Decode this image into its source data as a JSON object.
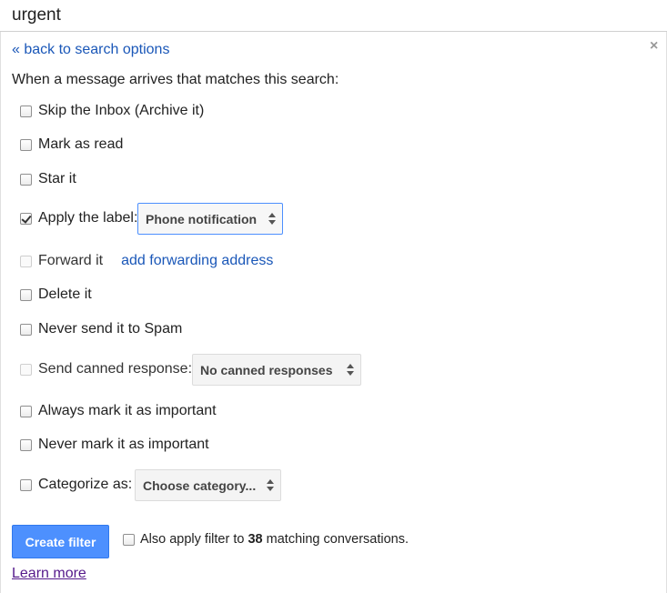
{
  "search": {
    "query": "urgent"
  },
  "close_glyph": "×",
  "back_link": "« back to search options",
  "intro": "When a message arrives that matches this search:",
  "actions": {
    "skip_inbox": {
      "label": "Skip the Inbox (Archive it)",
      "checked": false
    },
    "mark_read": {
      "label": "Mark as read",
      "checked": false
    },
    "star": {
      "label": "Star it",
      "checked": false
    },
    "apply_label": {
      "label": "Apply the label:",
      "checked": true,
      "select_value": "Phone notification"
    },
    "forward": {
      "label": "Forward it",
      "checked": false,
      "disabled": true,
      "link": "add forwarding address"
    },
    "delete": {
      "label": "Delete it",
      "checked": false
    },
    "never_spam": {
      "label": "Never send it to Spam",
      "checked": false
    },
    "canned": {
      "label": "Send canned response:",
      "checked": false,
      "disabled": true,
      "select_value": "No canned responses"
    },
    "always_important": {
      "label": "Always mark it as important",
      "checked": false
    },
    "never_important": {
      "label": "Never mark it as important",
      "checked": false
    },
    "categorize": {
      "label": "Categorize as:",
      "checked": false,
      "select_value": "Choose category..."
    }
  },
  "footer": {
    "create_button": "Create filter",
    "also_apply_prefix": "Also apply filter to",
    "also_apply_count": "38",
    "also_apply_suffix": "matching conversations.",
    "learn_more": "Learn more"
  },
  "colors": {
    "link": "#1a57b8",
    "button": "#4d90fe",
    "visited_link": "#551a8b",
    "select_focus_border": "#4d90fe"
  },
  "icons": {
    "close": "close-icon",
    "select_arrows": "up-down-arrows-icon",
    "checkmark": "checkmark-icon"
  }
}
